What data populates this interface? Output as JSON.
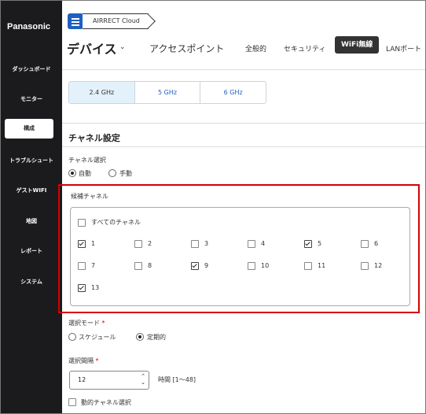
{
  "brand": "Panasonic",
  "sidebar": {
    "items": [
      {
        "label": "ダッシュボード"
      },
      {
        "label": "モニター"
      },
      {
        "label": "構成"
      },
      {
        "label": "トラブルシュート"
      },
      {
        "label": "ゲストWIFI"
      },
      {
        "label": "地図"
      },
      {
        "label": "レポート"
      },
      {
        "label": "システム"
      }
    ],
    "active": "構成"
  },
  "breadcrumb": "AIRRECT Cloud",
  "header": {
    "title": "デバイス",
    "tabs": [
      "アクセスポイント",
      "全般的",
      "セキュリティ",
      "WiFi無線",
      "LANポート"
    ],
    "active_tab": "WiFi無線"
  },
  "bands": [
    "2.4 GHz",
    "5 GHz",
    "6 GHz"
  ],
  "active_band": "2.4 GHz",
  "channel_settings": {
    "title": "チャネル設定",
    "selection": {
      "label": "チャネル選択",
      "options": [
        "自動",
        "手動"
      ],
      "selected": "自動"
    },
    "candidates": {
      "label": "候補チャネル",
      "all_label": "すべてのチャネル",
      "all_checked": false,
      "channels": [
        {
          "n": "1",
          "checked": true
        },
        {
          "n": "2",
          "checked": false
        },
        {
          "n": "3",
          "checked": false
        },
        {
          "n": "4",
          "checked": false
        },
        {
          "n": "5",
          "checked": true
        },
        {
          "n": "6",
          "checked": false
        },
        {
          "n": "7",
          "checked": false
        },
        {
          "n": "8",
          "checked": false
        },
        {
          "n": "9",
          "checked": true
        },
        {
          "n": "10",
          "checked": false
        },
        {
          "n": "11",
          "checked": false
        },
        {
          "n": "12",
          "checked": false
        },
        {
          "n": "13",
          "checked": true
        }
      ]
    },
    "mode": {
      "label": "選択モード",
      "required": "*",
      "options": [
        "スケジュール",
        "定期的"
      ],
      "selected": "定期的"
    },
    "interval": {
      "label": "選択間隔",
      "required": "*",
      "value": "12",
      "unit": "時間 [1〜48]"
    },
    "dynamic": {
      "label": "動的チャネル選択",
      "checked": false
    }
  },
  "colors": {
    "sidebar_bg": "#1b1b1d",
    "accent": "#1f5fbf",
    "highlight": "#d50000",
    "active_tab_bg": "#333333"
  }
}
